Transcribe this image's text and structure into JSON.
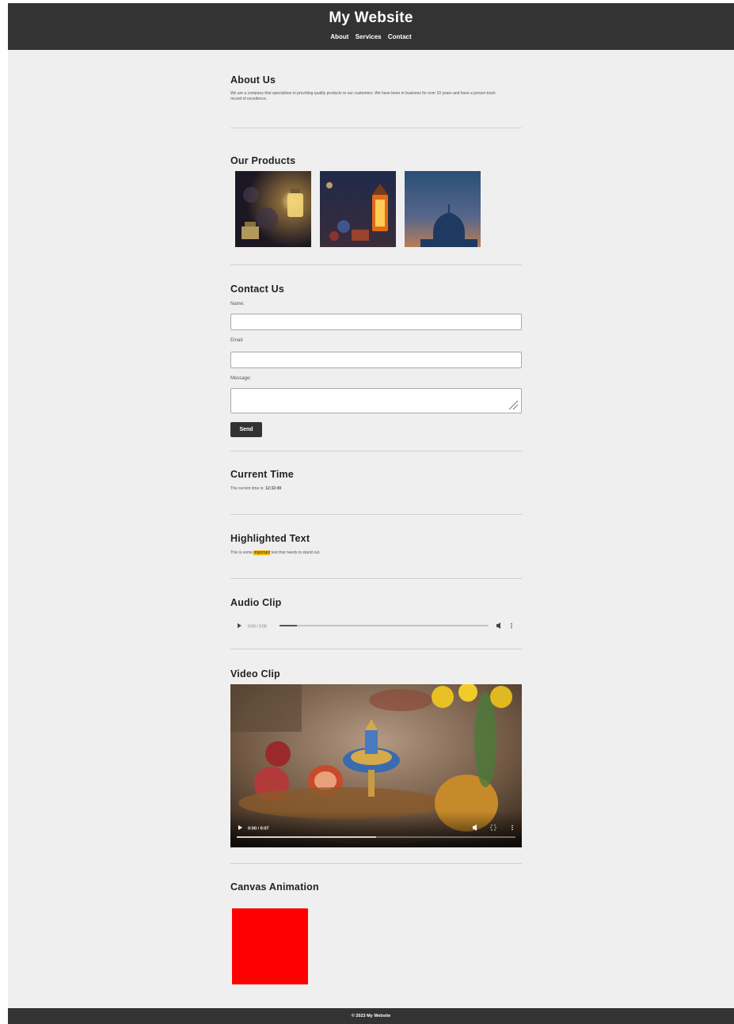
{
  "header": {
    "title": "My Website",
    "nav": [
      "About",
      "Services",
      "Contact"
    ]
  },
  "about": {
    "heading": "About Us",
    "text": "We are a company that specializes in providing quality products to our customers. We have been in business for over 10 years and have a proven track record of excellence."
  },
  "products": {
    "heading": "Our Products",
    "images": [
      "lantern-icon",
      "lantern-icon",
      "mosque-dome-icon"
    ]
  },
  "contact": {
    "heading": "Contact Us",
    "name_label": "Name:",
    "name_value": "",
    "email_label": "Email:",
    "email_value": "",
    "message_label": "Message:",
    "message_value": "",
    "send_label": "Send"
  },
  "time": {
    "heading": "Current Time",
    "prefix": "The current time is: ",
    "value": "12:32:49"
  },
  "highlight": {
    "heading": "Highlighted Text",
    "before": "This is some ",
    "marked": "important",
    "after": " text that needs to stand out."
  },
  "audio": {
    "heading": "Audio Clip",
    "time": "0:00 / 0:00"
  },
  "video": {
    "heading": "Video Clip",
    "time": "0:00 / 0:07",
    "progress": 0.5
  },
  "canvas": {
    "heading": "Canvas Animation",
    "color": "#ff0000"
  },
  "footer": {
    "text": "© 2023 My Website"
  },
  "colors": {
    "header_bg": "#333333",
    "page_bg": "#efefef",
    "highlight": "#f2b800"
  }
}
